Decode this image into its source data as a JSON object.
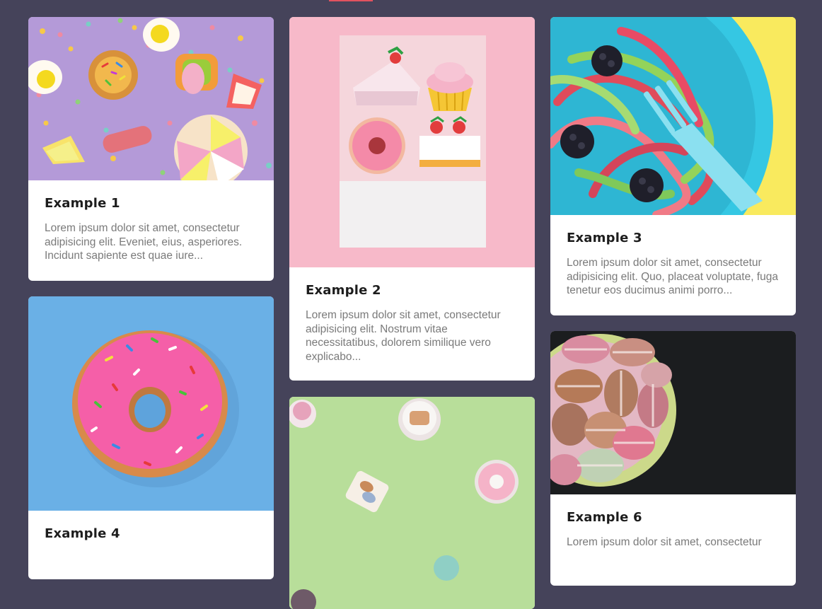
{
  "cards": [
    {
      "title": "Example 1",
      "text": "Lorem ipsum dolor sit amet, consectetur adipisicing elit. Eveniet, eius, asperiores. Incidunt sapiente est quae iure...",
      "image": "candy-sprinkles-photo"
    },
    {
      "title": "Example 2",
      "text": "Lorem ipsum dolor sit amet, consectetur adipisicing elit. Nostrum vitae necessitatibus, dolorem similique vero explicabo...",
      "image": "pastry-erasers-photo"
    },
    {
      "title": "Example 3",
      "text": "Lorem ipsum dolor sit amet, consectetur adipisicing elit. Quo, placeat voluptate, fuga tenetur eos ducimus animi porro...",
      "image": "gummy-candy-bowl-photo"
    },
    {
      "title": "Example 4",
      "text": "",
      "image": "pink-donut-photo"
    },
    {
      "title": "",
      "text": "",
      "image": "mini-sweets-green-photo"
    },
    {
      "title": "Example 6",
      "text": "Lorem ipsum dolor sit amet, consectetur",
      "image": "macarons-bowl-photo"
    }
  ],
  "colors": {
    "background": "#45435a",
    "card": "#ffffff",
    "title": "#1d1d1d",
    "text": "#7a7a7a",
    "accent": "#e2525f"
  }
}
